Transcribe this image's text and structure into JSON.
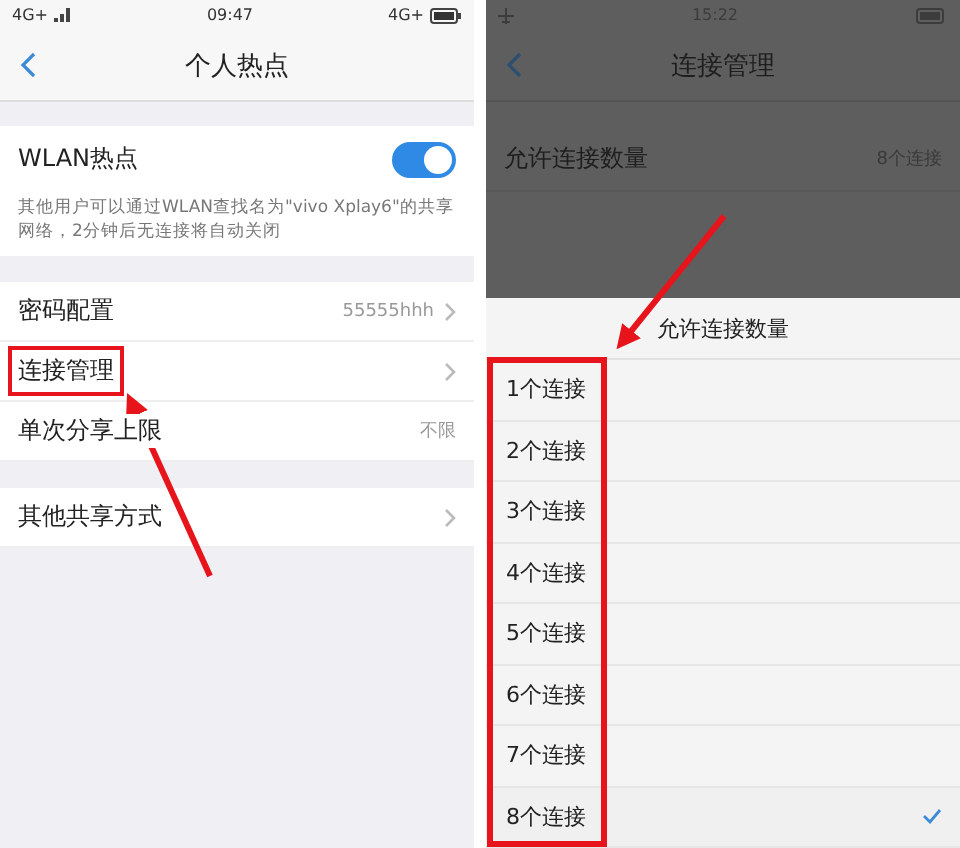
{
  "hotspot_screen": {
    "status_bar": {
      "network": "4G+",
      "time": "09:47",
      "network_right": "4G+"
    },
    "title": "个人热点",
    "wlan": {
      "label": "WLAN热点",
      "on": true,
      "description": "其他用户可以通过WLAN查找名为\"vivo Xplay6\"的共享网络，2分钟后无连接将自动关闭"
    },
    "settings": [
      {
        "label": "密码配置",
        "value": "55555hhh",
        "highlighted": false
      },
      {
        "label": "连接管理",
        "highlighted": true
      },
      {
        "label": "单次分享上限",
        "value": "不限",
        "highlighted": false
      }
    ],
    "other": {
      "label": "其他共享方式"
    }
  },
  "connection_screen": {
    "status_bar": {
      "time": "15:22"
    },
    "title": "连接管理",
    "row": {
      "label": "允许连接数量",
      "value": "8个连接"
    },
    "sheet": {
      "title": "允许连接数量",
      "options": [
        {
          "label": "1个连接",
          "selected": false
        },
        {
          "label": "2个连接",
          "selected": false
        },
        {
          "label": "3个连接",
          "selected": false
        },
        {
          "label": "4个连接",
          "selected": false
        },
        {
          "label": "5个连接",
          "selected": false
        },
        {
          "label": "6个连接",
          "selected": false
        },
        {
          "label": "7个连接",
          "selected": false
        },
        {
          "label": "8个连接",
          "selected": true
        }
      ]
    }
  }
}
